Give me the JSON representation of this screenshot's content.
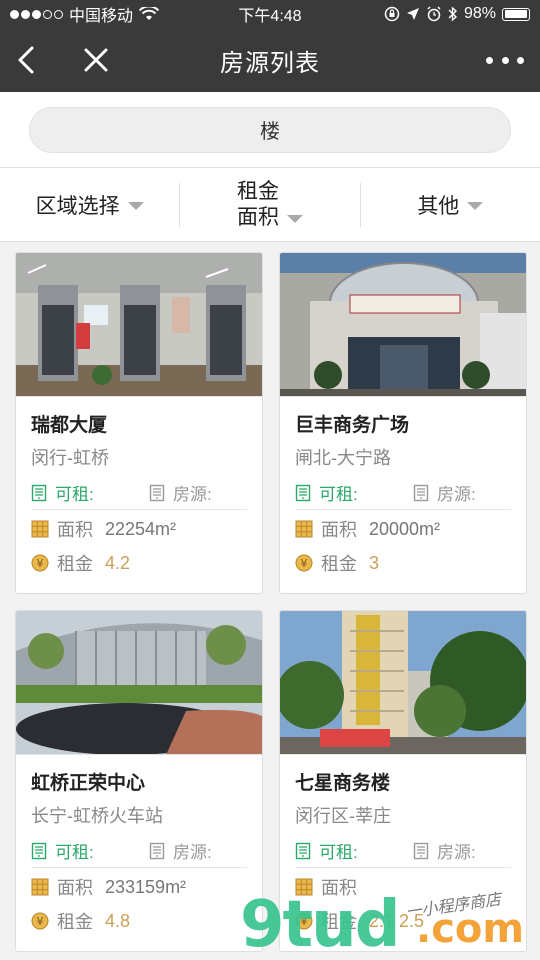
{
  "status_bar": {
    "carrier": "中国移动",
    "time": "下午4:48",
    "battery": "98%"
  },
  "nav": {
    "title": "房源列表"
  },
  "search": {
    "value": "楼"
  },
  "filters": {
    "region": "区域选择",
    "rent_area_line1": "租金",
    "rent_area_line2": "面积",
    "other": "其他"
  },
  "labels": {
    "available": "可租:",
    "source": "房源:",
    "area": "面积",
    "rent": "租金"
  },
  "listings": [
    {
      "name": "瑞都大厦",
      "location": "闵行-虹桥",
      "area": "22254m²",
      "rent": "4.2"
    },
    {
      "name": "巨丰商务广场",
      "location": "闸北-大宁路",
      "area": "20000m²",
      "rent": "3"
    },
    {
      "name": "虹桥正荣中心",
      "location": "长宁-虹桥火车站",
      "area": "233159m²",
      "rent": "4.8"
    },
    {
      "name": "七星商务楼",
      "location": "闵行区-莘庄",
      "area": "",
      "rent": "2.1 2.5"
    }
  ],
  "watermark": {
    "brand": "9tud",
    "suffix": ".com",
    "script": "一小程序商店"
  },
  "colors": {
    "nav_bg": "#3a3a3a",
    "available_green": "#2aa86a",
    "rent_gold": "#c9a159"
  }
}
